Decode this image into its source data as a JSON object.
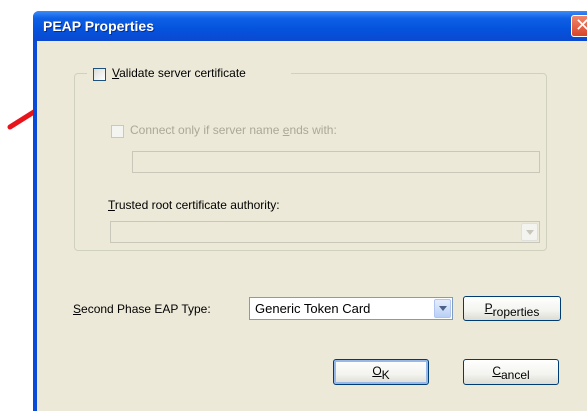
{
  "dialog": {
    "title": "PEAP Properties",
    "close_glyph": "✕"
  },
  "validate": {
    "prefix": "",
    "accel": "V",
    "rest": "alidate server certificate",
    "checked": false
  },
  "connect_only": {
    "prefix": "Connect only if server name ",
    "accel": "e",
    "rest": "nds with:",
    "value": "",
    "enabled": false
  },
  "trusted_root": {
    "accel": "T",
    "rest": "rusted root certificate authority:",
    "value": "",
    "enabled": false
  },
  "second_phase": {
    "prefix": "",
    "accel": "S",
    "rest": "econd Phase EAP Type:",
    "selected": "Generic Token Card"
  },
  "buttons": {
    "properties": {
      "accel": "P",
      "rest": "roperties"
    },
    "ok": {
      "accel": "O",
      "rest": "K"
    },
    "cancel": {
      "accel": "C",
      "rest": "ancel"
    }
  },
  "annotation": {
    "color": "#e8141c"
  }
}
